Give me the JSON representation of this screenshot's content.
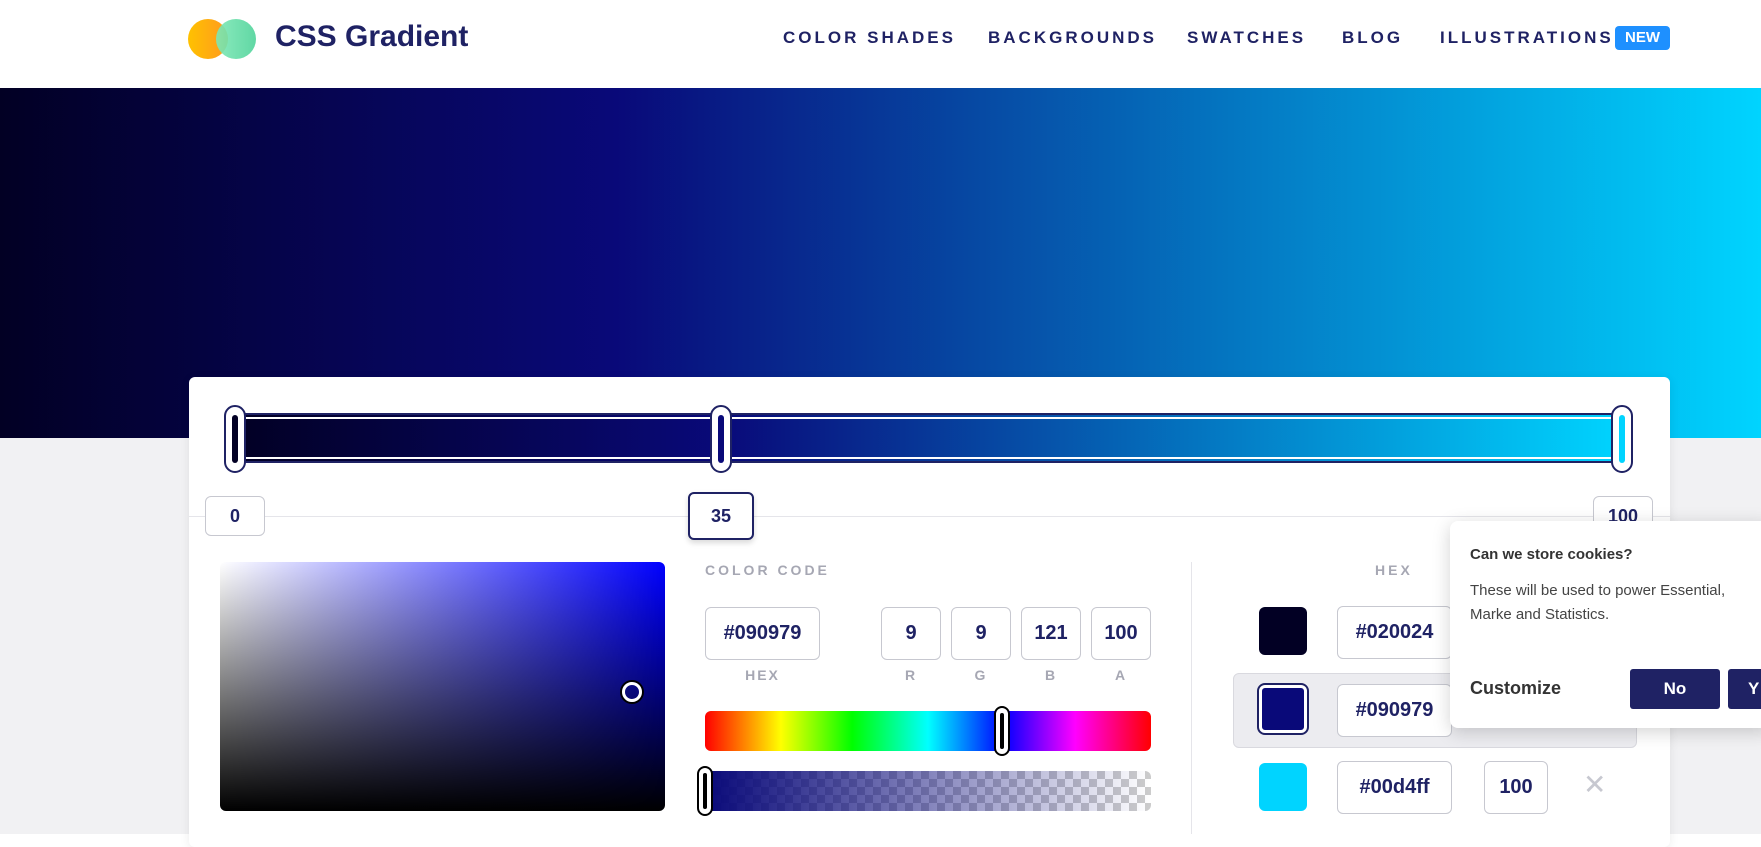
{
  "header": {
    "brand": "CSS Gradient",
    "nav": [
      "COLOR SHADES",
      "BACKGROUNDS",
      "SWATCHES",
      "BLOG",
      "ILLUSTRATIONS"
    ],
    "badge": "NEW"
  },
  "gradient": {
    "colors": [
      "#020024",
      "#090979",
      "#00d4ff"
    ],
    "stops": [
      "0",
      "35",
      "100"
    ],
    "active_stop": "35"
  },
  "editor": {
    "color_code_label": "COLOR CODE",
    "hex_value": "#090979",
    "hex_label": "HEX",
    "r": "9",
    "g": "9",
    "b": "121",
    "a": "100",
    "r_label": "R",
    "g_label": "G",
    "b_label": "B",
    "a_label": "A"
  },
  "stops_list": {
    "header": "HEX",
    "rows": [
      {
        "hex": "#020024",
        "color": "#020024"
      },
      {
        "hex": "#090979",
        "color": "#090979"
      },
      {
        "hex": "#00d4ff",
        "color": "#00d4ff",
        "alpha": "100"
      }
    ]
  },
  "cookie": {
    "title": "Can we store cookies?",
    "body": "These will be used to power Essential, Marke and Statistics.",
    "customize": "Customize",
    "no": "No",
    "yes": "Y"
  }
}
